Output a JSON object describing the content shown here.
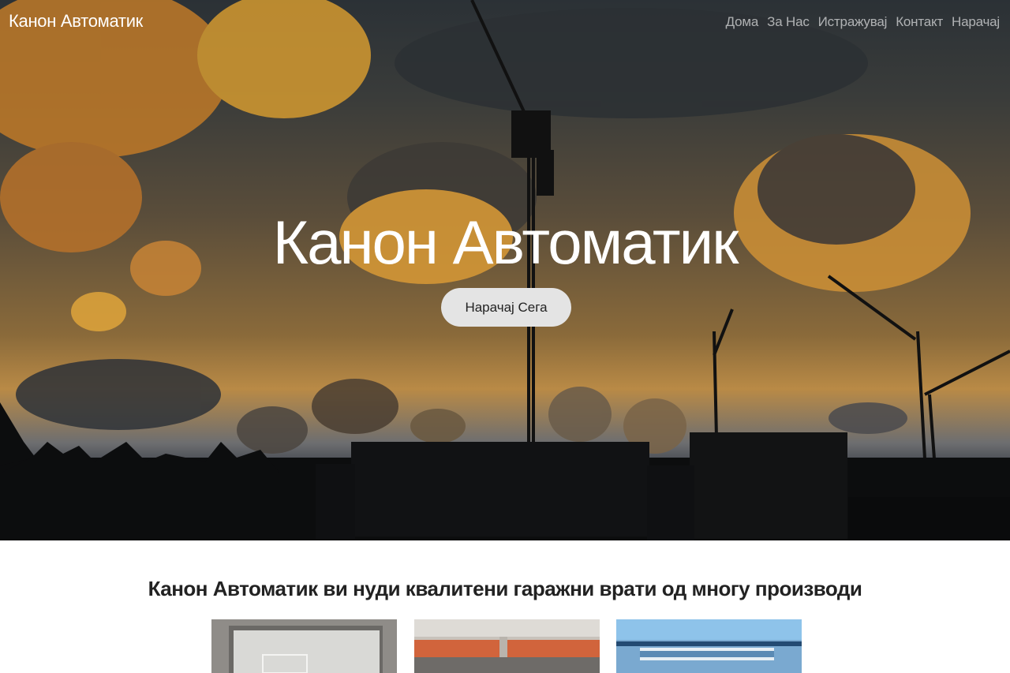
{
  "header": {
    "brand": "Канон Автоматик",
    "nav": [
      {
        "label": "Дома"
      },
      {
        "label": "За Нас"
      },
      {
        "label": "Истражувај"
      },
      {
        "label": "Контакт"
      },
      {
        "label": "Нарачај"
      }
    ]
  },
  "hero": {
    "title": "Канон Автоматик",
    "cta_label": "Нарачај Сега"
  },
  "products": {
    "heading": "Канон Автоматик ви нуди квалитени гаражни врати од многу производи"
  },
  "colors": {
    "cta_bg": "#e4e4e4",
    "nav_text": "#ffffff"
  }
}
